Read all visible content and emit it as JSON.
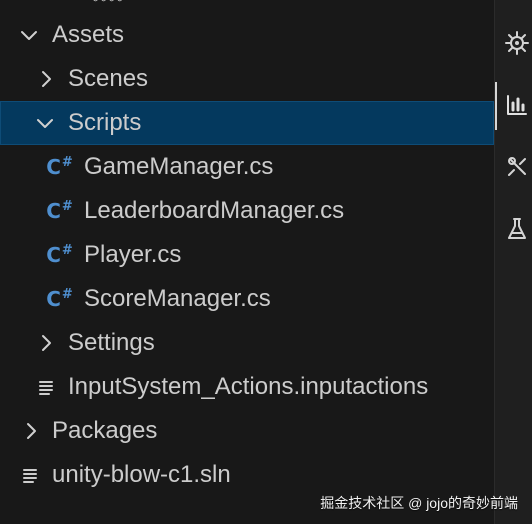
{
  "explorer": {
    "items": [
      {
        "label": "Assets",
        "kind": "folder",
        "expanded": true,
        "icon": "chevron-down-icon"
      },
      {
        "label": "Scenes",
        "kind": "folder",
        "expanded": false,
        "icon": "chevron-right-icon"
      },
      {
        "label": "Scripts",
        "kind": "folder",
        "expanded": true,
        "selected": true,
        "icon": "chevron-down-icon"
      },
      {
        "label": "GameManager.cs",
        "kind": "file",
        "icon": "csharp-file-icon",
        "icon_text": "C",
        "icon_suffix": "#"
      },
      {
        "label": "LeaderboardManager.cs",
        "kind": "file",
        "icon": "csharp-file-icon",
        "icon_text": "C",
        "icon_suffix": "#"
      },
      {
        "label": "Player.cs",
        "kind": "file",
        "icon": "csharp-file-icon",
        "icon_text": "C",
        "icon_suffix": "#"
      },
      {
        "label": "ScoreManager.cs",
        "kind": "file",
        "icon": "csharp-file-icon",
        "icon_text": "C",
        "icon_suffix": "#"
      },
      {
        "label": "Settings",
        "kind": "folder",
        "expanded": false,
        "icon": "chevron-right-icon"
      },
      {
        "label": "InputSystem_Actions.inputactions",
        "kind": "file",
        "icon": "text-file-icon"
      },
      {
        "label": "Packages",
        "kind": "folder",
        "expanded": false,
        "icon": "chevron-right-icon"
      },
      {
        "label": "unity-blow-c1.sln",
        "kind": "file",
        "icon": "text-file-icon"
      }
    ],
    "top_fragment": "◦◦◦◦"
  },
  "activity_bar": {
    "icons": [
      "gear-icon",
      "chart-icon",
      "tools-icon",
      "flask-icon"
    ]
  },
  "watermark": {
    "text": "掘金技术社区 @ jojo的奇妙前端"
  },
  "colors": {
    "background": "#181818",
    "selection": "#04395e",
    "text": "#cccccc",
    "csharp": "#4f8fcf"
  }
}
